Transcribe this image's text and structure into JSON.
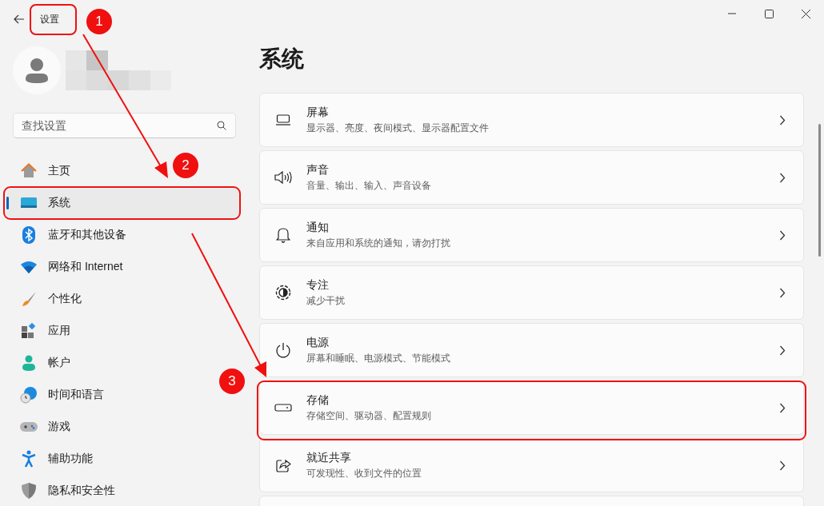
{
  "window": {
    "title": "设置"
  },
  "search": {
    "placeholder": "查找设置"
  },
  "nav": [
    {
      "label": "主页",
      "selected": false
    },
    {
      "label": "系统",
      "selected": true
    },
    {
      "label": "蓝牙和其他设备",
      "selected": false
    },
    {
      "label": "网络和 Internet",
      "selected": false
    },
    {
      "label": "个性化",
      "selected": false
    },
    {
      "label": "应用",
      "selected": false
    },
    {
      "label": "帐户",
      "selected": false
    },
    {
      "label": "时间和语言",
      "selected": false
    },
    {
      "label": "游戏",
      "selected": false
    },
    {
      "label": "辅助功能",
      "selected": false
    },
    {
      "label": "隐私和安全性",
      "selected": false
    }
  ],
  "page_title": "系统",
  "cards": [
    {
      "title": "屏幕",
      "subtitle": "显示器、亮度、夜间模式、显示器配置文件"
    },
    {
      "title": "声音",
      "subtitle": "音量、输出、输入、声音设备"
    },
    {
      "title": "通知",
      "subtitle": "来自应用和系统的通知，请勿打扰"
    },
    {
      "title": "专注",
      "subtitle": "减少干扰"
    },
    {
      "title": "电源",
      "subtitle": "屏幕和睡眠、电源模式、节能模式"
    },
    {
      "title": "存储",
      "subtitle": "存储空间、驱动器、配置规则"
    },
    {
      "title": "就近共享",
      "subtitle": "可发现性、收到文件的位置"
    }
  ],
  "annotations": [
    {
      "number": "1"
    },
    {
      "number": "2"
    },
    {
      "number": "3"
    }
  ]
}
